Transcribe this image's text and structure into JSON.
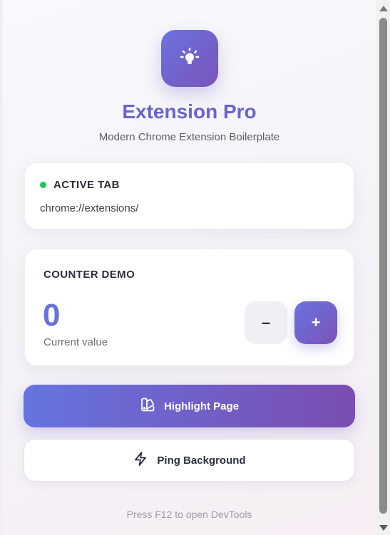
{
  "header": {
    "title": "Extension Pro",
    "subtitle": "Modern Chrome Extension Boilerplate",
    "logo_icon": "lightbulb-icon"
  },
  "active_tab": {
    "label": "ACTIVE TAB",
    "url": "chrome://extensions/",
    "status_color": "#22c55e"
  },
  "counter": {
    "label": "COUNTER DEMO",
    "value": "0",
    "caption": "Current value",
    "decrement_label": "–",
    "increment_label": "+"
  },
  "actions": {
    "highlight_label": "Highlight Page",
    "highlight_icon": "palette-swatch-icon",
    "ping_label": "Ping Background",
    "ping_icon": "lightning-icon"
  },
  "footer": {
    "hint": "Press F12 to open DevTools"
  },
  "colors": {
    "accent_start": "#6a72e0",
    "accent_end": "#7b54b8",
    "title": "#6a63cf"
  }
}
